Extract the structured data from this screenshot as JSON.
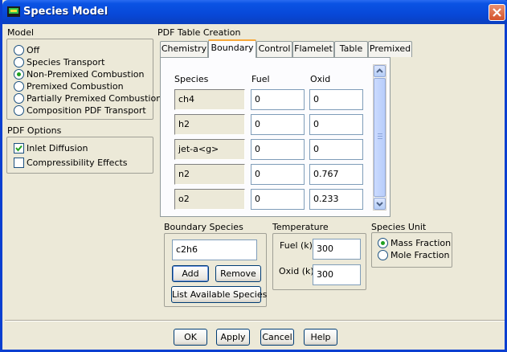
{
  "window": {
    "title": "Species Model"
  },
  "model": {
    "label": "Model",
    "options": [
      "Off",
      "Species Transport",
      "Non-Premixed Combustion",
      "Premixed Combustion",
      "Partially Premixed Combustion",
      "Composition PDF Transport"
    ],
    "selected": "Non-Premixed Combustion"
  },
  "pdf_options": {
    "label": "PDF Options",
    "inlet_diffusion": {
      "label": "Inlet Diffusion",
      "checked": true
    },
    "compressibility": {
      "label": "Compressibility Effects",
      "checked": false
    }
  },
  "pdf_table": {
    "label": "PDF Table Creation",
    "tabs": [
      "Chemistry",
      "Boundary",
      "Control",
      "Flamelet",
      "Table",
      "Premixed"
    ],
    "active_tab": "Boundary",
    "columns": [
      "Species",
      "Fuel",
      "Oxid"
    ],
    "rows": [
      {
        "species": "ch4",
        "fuel": "0",
        "oxid": "0"
      },
      {
        "species": "h2",
        "fuel": "0",
        "oxid": "0"
      },
      {
        "species": "jet-a<g>",
        "fuel": "0",
        "oxid": "0"
      },
      {
        "species": "n2",
        "fuel": "0",
        "oxid": "0.767"
      },
      {
        "species": "o2",
        "fuel": "0",
        "oxid": "0.233"
      }
    ]
  },
  "boundary_species": {
    "label": "Boundary Species",
    "value": "c2h6",
    "add_label": "Add",
    "remove_label": "Remove",
    "list_label": "List Available Species"
  },
  "temperature": {
    "label": "Temperature",
    "fuel_label": "Fuel (k)",
    "fuel_value": "300",
    "oxid_label": "Oxid (k)",
    "oxid_value": "300"
  },
  "species_unit": {
    "label": "Species Unit",
    "options": [
      "Mass Fraction",
      "Mole Fraction"
    ],
    "selected": "Mass Fraction"
  },
  "footer": {
    "ok": "OK",
    "apply": "Apply",
    "cancel": "Cancel",
    "help": "Help"
  }
}
